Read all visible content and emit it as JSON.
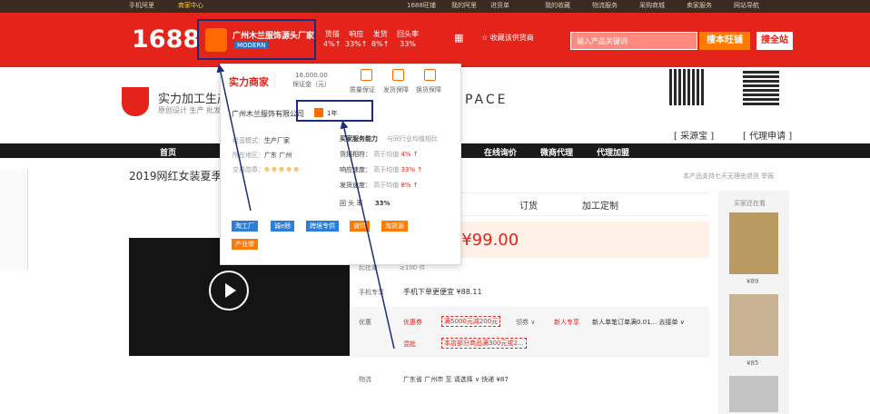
{
  "top_strip": {
    "links": [
      "手机阿里",
      "商家中心",
      "1688旺铺",
      "我的阿里",
      "进货单",
      "我的收藏",
      "物流服务",
      "采购商城",
      "卖家服务",
      "网站导航"
    ]
  },
  "header": {
    "logo": "1688",
    "shop_name": "广州木兰服饰源头厂家",
    "shop_badge": "MODERN",
    "stats": [
      {
        "label": "货描",
        "value": "4%↑"
      },
      {
        "label": "响应",
        "value": "33%↑"
      },
      {
        "label": "发货",
        "value": "8%↑"
      },
      {
        "label": "回头率",
        "value": "33%"
      }
    ],
    "favorite_label": "☆ 收藏该供货商",
    "search_placeholder": "输入产品关键词",
    "search_button": "搜本旺铺",
    "search_all_button": "搜全站"
  },
  "company": {
    "name": "实力加工生产",
    "sub": "原创设计 生产 批发",
    "brand": "PACE",
    "qr1_label": "[ 采源宝 ]",
    "qr2_label": "[ 代理申请 ]"
  },
  "nav": {
    "items": [
      "首页",
      "在线询价",
      "微商代理",
      "代理加盟"
    ]
  },
  "product": {
    "title": "2019网红女装夏季新款",
    "tabs": [
      "订货",
      "加工定制"
    ],
    "price": "- ¥99.00",
    "qty_label": "起批量",
    "qty_value": "≥100 件",
    "mobile_label": "手机专享",
    "mobile_value": "手机下单更便宜 ¥88.11",
    "coupon_label": "优惠",
    "coupon_type": "优惠券",
    "coupon_value": "满5000元减200元",
    "coupon_more": "领券 ∨",
    "coupon_new": "新人专享",
    "coupon_new_desc": "新人单笔订单满0.01...  去接单 ∨",
    "mix_label": "混批",
    "mix_value": "本店部分商品满300元或2...",
    "ship_label": "物流",
    "ship_value": "广东省 广州市  至  请选择 ∨  快递 ¥87",
    "right_note": "本产品支持七天无理由退货   举报",
    "also_title": "买家还在看",
    "also_prices": [
      "¥89",
      "¥85"
    ]
  },
  "popup": {
    "strength_label": "实力商家",
    "deposit_value": "16,000.00",
    "deposit_label": "保证金（元）",
    "guarantees": [
      "质量保证",
      "发货保障",
      "换货保障"
    ],
    "company_name": "广州木兰服饰有限公司",
    "years": "1年",
    "left_rows": [
      {
        "key": "经营模式：",
        "value": "生产厂家"
      },
      {
        "key": "所在地区：",
        "value": "广东 广州"
      },
      {
        "key": "交易勋章：",
        "value": ""
      }
    ],
    "service_title": "买家服务能力",
    "service_compare": "与同行业均值相比",
    "service_rows": [
      {
        "key": "货描相符：",
        "desc": "高于均值",
        "value": "4%",
        "arrow": "↑"
      },
      {
        "key": "响应速度：",
        "desc": "高于均值",
        "value": "33%",
        "arrow": "↑"
      },
      {
        "key": "发货速度：",
        "desc": "高于均值",
        "value": "8%",
        "arrow": "↑"
      }
    ],
    "repurchase_key": "回 头 率",
    "repurchase_value": "33%",
    "tags": [
      {
        "label": "淘工厂",
        "color": "#2e7dd7"
      },
      {
        "label": "诚e赊",
        "color": "#2e7dd7"
      },
      {
        "label": "跨境专供",
        "color": "#2e7dd7"
      },
      {
        "label": "微供",
        "color": "#ff7a00"
      },
      {
        "label": "淘货源",
        "color": "#ff7a00"
      },
      {
        "label": "产业带",
        "color": "#ff7a00"
      }
    ]
  }
}
